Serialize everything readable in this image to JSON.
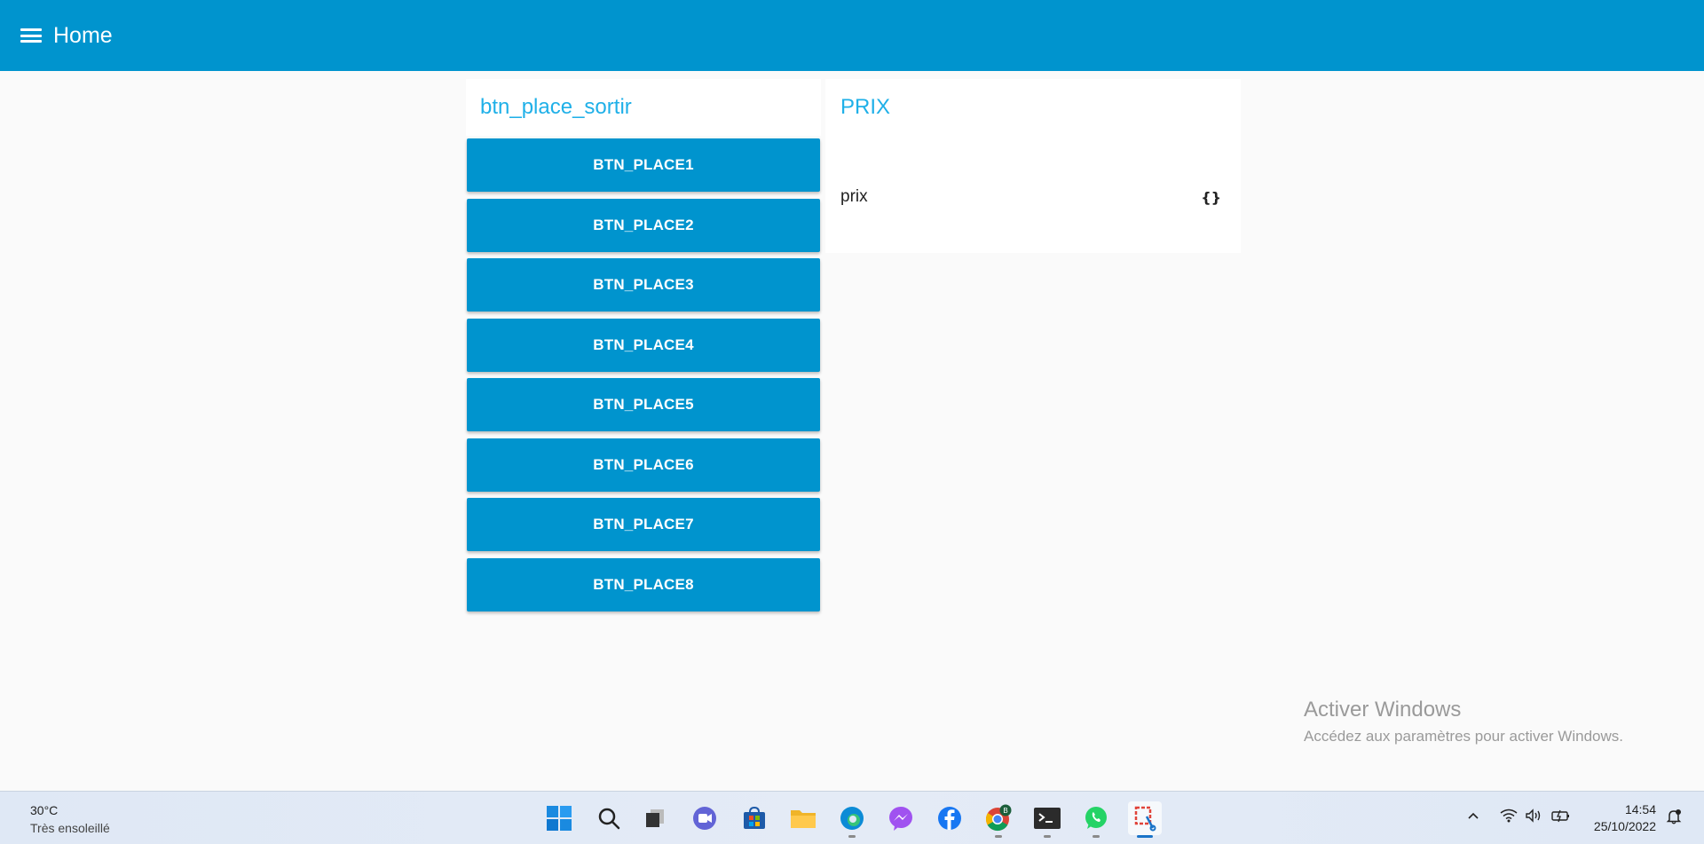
{
  "header": {
    "title": "Home",
    "menu_icon": "menu-icon"
  },
  "groups": [
    {
      "title": "btn_place_sortir",
      "buttons": [
        "BTN_PLACE1",
        "BTN_PLACE2",
        "BTN_PLACE3",
        "BTN_PLACE4",
        "BTN_PLACE5",
        "BTN_PLACE6",
        "BTN_PLACE7",
        "BTN_PLACE8"
      ]
    },
    {
      "title": "PRIX",
      "row": {
        "label": "prix",
        "value": "{}"
      }
    }
  ],
  "watermark": {
    "line1": "Activer Windows",
    "line2": "Accédez aux paramètres pour activer Windows."
  },
  "taskbar": {
    "weather": {
      "temp": "30°C",
      "desc": "Très ensoleillé"
    },
    "apps": [
      "windows-start-icon",
      "search-icon",
      "task-view-icon",
      "teams-icon",
      "store-icon",
      "file-explorer-icon",
      "edge-icon",
      "messenger-icon",
      "facebook-icon",
      "chrome-icon",
      "terminal-icon",
      "whatsapp-icon",
      "snipping-tool-icon"
    ],
    "chrome_badge": "B",
    "clock": {
      "time": "14:54",
      "date": "25/10/2022"
    }
  },
  "colors": {
    "primary": "#0094ce",
    "group_title": "#1fb0e8",
    "background": "#fafafa"
  }
}
